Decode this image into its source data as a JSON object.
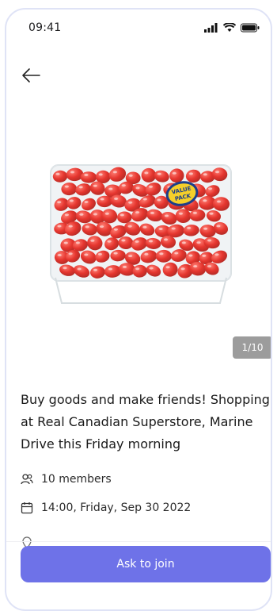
{
  "status_bar": {
    "time": "09:41"
  },
  "product": {
    "image_label": "VALUE PACK",
    "pager": "1/10"
  },
  "event": {
    "title": "Buy goods and make friends! Shopping at Real Canadian Superstore, Marine Drive this Friday morning",
    "members": "10 members",
    "datetime": "14:00, Friday, Sep 30 2022"
  },
  "actions": {
    "join_label": "Ask to join"
  },
  "colors": {
    "accent": "#6e72e8",
    "tomato": "#e21a12"
  }
}
